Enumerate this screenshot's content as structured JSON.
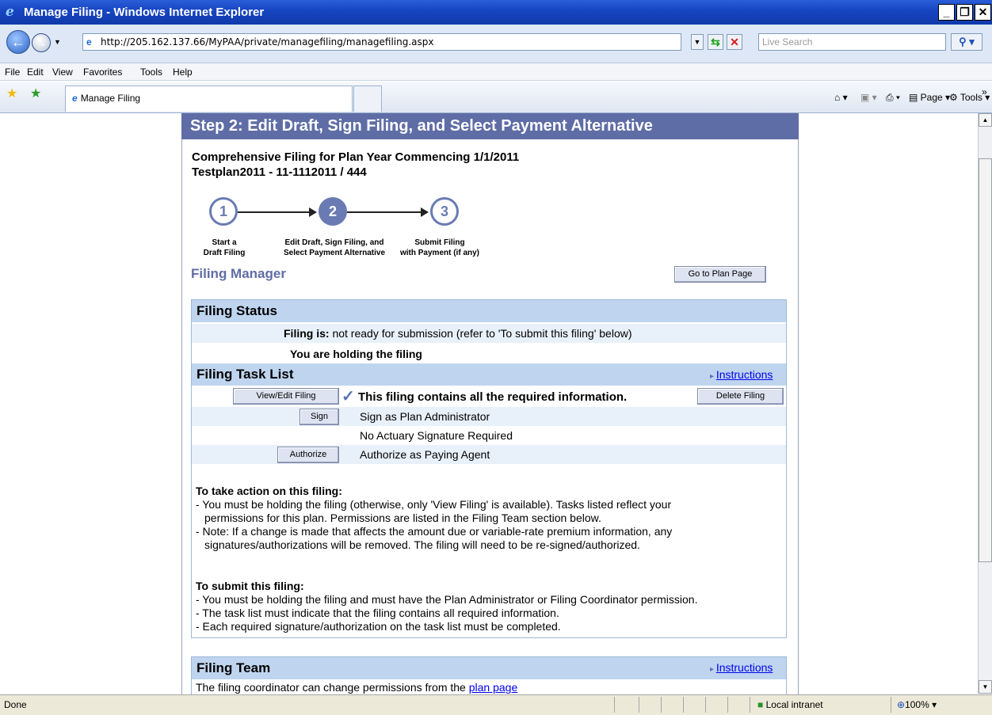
{
  "window": {
    "title": "Manage Filing - Windows Internet Explorer",
    "controls": [
      "_",
      "❐",
      "✕"
    ]
  },
  "address": {
    "url": "http://205.162.137.66/MyPAA/private/managefiling/managefiling.aspx",
    "search_placeholder": "Live Search"
  },
  "menu": [
    "File",
    "Edit",
    "View",
    "Favorites",
    "Tools",
    "Help"
  ],
  "tab": {
    "label": "Manage Filing"
  },
  "commands": {
    "page": "Page",
    "tools": "Tools"
  },
  "page": {
    "step_header": "Step 2: Edit Draft, Sign Filing, and Select Payment Alternative",
    "filing_line": "Comprehensive Filing for Plan Year Commencing 1/1/2011",
    "plan_line": "Testplan2011 - 11-1112011 / 444",
    "steps": [
      {
        "num": "1",
        "label_l1": "Start a",
        "label_l2": "Draft Filing"
      },
      {
        "num": "2",
        "label_l1": "Edit Draft, Sign Filing, and",
        "label_l2": "Select Payment Alternative"
      },
      {
        "num": "3",
        "label_l1": "Submit Filing",
        "label_l2": "with Payment (if any)"
      }
    ],
    "filing_manager_title": "Filing Manager",
    "go_to_plan_button": "Go to Plan Page",
    "status": {
      "title": "Filing Status",
      "filing_is_label": "Filing is:",
      "filing_is_value": "not ready for submission (refer to 'To submit this filing' below)",
      "holding_text": "You are holding the filing"
    },
    "tasks": {
      "title": "Filing Task List",
      "instructions_link": "Instructions",
      "view_edit_button": "View/Edit Filing",
      "complete_text": "This filing contains all the required information.",
      "delete_button": "Delete Filing",
      "sign_button": "Sign",
      "sign_text": "Sign as Plan Administrator",
      "actuary_text": "No Actuary Signature Required",
      "authorize_button": "Authorize",
      "authorize_text": "Authorize as Paying Agent"
    },
    "take_action": {
      "title": "To take action on this filing:",
      "l1": "- You must be holding the filing (otherwise, only 'View Filing' is available). Tasks listed reflect your",
      "l2": "permissions for this plan. Permissions are listed in the Filing Team section below.",
      "l3": "- Note: If a change is made that affects the amount due or variable-rate premium information, any",
      "l4": "signatures/authorizations will be removed. The filing will need to be re-signed/authorized."
    },
    "submit": {
      "title": "To submit this filing:",
      "l1": "- You must be holding the filing and must have the Plan Administrator or Filing Coordinator permission.",
      "l2": "- The task list must indicate that the filing contains all required information.",
      "l3": "- Each required signature/authorization on the task list must be completed."
    },
    "team": {
      "title": "Filing Team",
      "instructions_link": "Instructions",
      "text": "The filing coordinator can change permissions from the",
      "link": "plan page"
    }
  },
  "status_bar": {
    "left": "Done",
    "zone": "Local intranet",
    "zoom": "100%"
  }
}
